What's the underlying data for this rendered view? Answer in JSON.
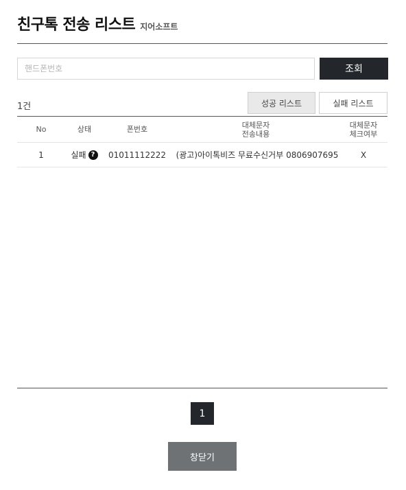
{
  "header": {
    "title": "친구톡 전송 리스트",
    "subtitle": "지어소프트"
  },
  "search": {
    "placeholder": "핸드폰번호",
    "value": "",
    "button_label": "조회"
  },
  "summary": {
    "count": "1건"
  },
  "filters": {
    "success_label": "성공 리스트",
    "fail_label": "실패 리스트"
  },
  "table": {
    "headers": {
      "no": "No",
      "status": "상태",
      "phone": "폰번호",
      "alt_content_line1": "대체문자",
      "alt_content_line2": "전송내용",
      "alt_check_line1": "대체문자",
      "alt_check_line2": "체크여부"
    },
    "rows": [
      {
        "no": "1",
        "status": "실패",
        "status_icon": "?",
        "phone": "01011112222",
        "alt_content": "(광고)아이톡비즈 무료수신거부 0806907695",
        "alt_check": "X"
      }
    ]
  },
  "pagination": {
    "current": "1"
  },
  "footer": {
    "close_label": "창닫기"
  },
  "colors": {
    "dark": "#23272b",
    "close": "#6f7275",
    "text": "#333333"
  }
}
